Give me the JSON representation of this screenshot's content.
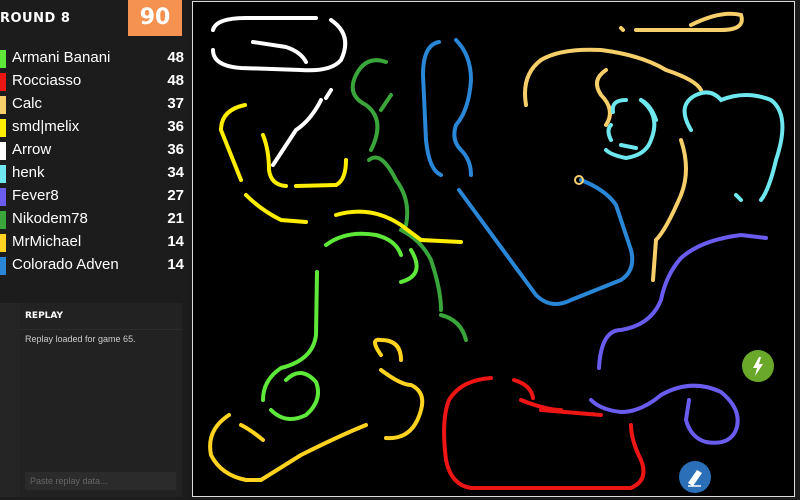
{
  "header": {
    "round": "ROUND 8",
    "timer": "90"
  },
  "players": [
    {
      "name": "Armani Banani",
      "score": "48",
      "color": "#5ee83a"
    },
    {
      "name": "Rocciasso",
      "score": "48",
      "color": "#ee1515"
    },
    {
      "name": "Calc",
      "score": "37",
      "color": "#f6cf6b"
    },
    {
      "name": "smd|melix",
      "score": "36",
      "color": "#ffee00"
    },
    {
      "name": "Arrow",
      "score": "36",
      "color": "#ffffff"
    },
    {
      "name": "henk",
      "score": "34",
      "color": "#6ee8ee"
    },
    {
      "name": "Fever8",
      "score": "27",
      "color": "#6b5cf0"
    },
    {
      "name": "Nikodem78",
      "score": "21",
      "color": "#3aa53a"
    },
    {
      "name": "MrMichael",
      "score": "14",
      "color": "#ffd31f"
    },
    {
      "name": "Colorado Adven",
      "score": "14",
      "color": "#2a86d6"
    }
  ],
  "replay": {
    "title": "REPLAY",
    "message": "Replay loaded for game 65.",
    "input_placeholder": "Paste replay data..."
  },
  "powerups": [
    {
      "icon": "lightning-icon",
      "color": "#6aa82a"
    },
    {
      "icon": "eraser-icon",
      "color": "#2a6fb8"
    }
  ]
}
